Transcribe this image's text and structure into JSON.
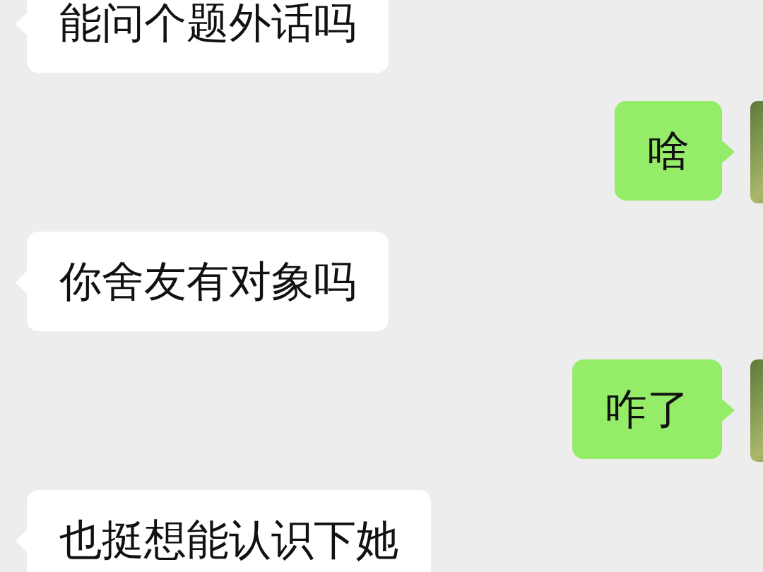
{
  "messages": [
    {
      "kind": "received",
      "text": "能问个题外话吗"
    },
    {
      "kind": "sent",
      "text": "啥"
    },
    {
      "kind": "received",
      "text": "你舍友有对象吗"
    },
    {
      "kind": "sent",
      "text": "咋了"
    },
    {
      "kind": "received",
      "text": "也挺想能认识下她"
    }
  ]
}
